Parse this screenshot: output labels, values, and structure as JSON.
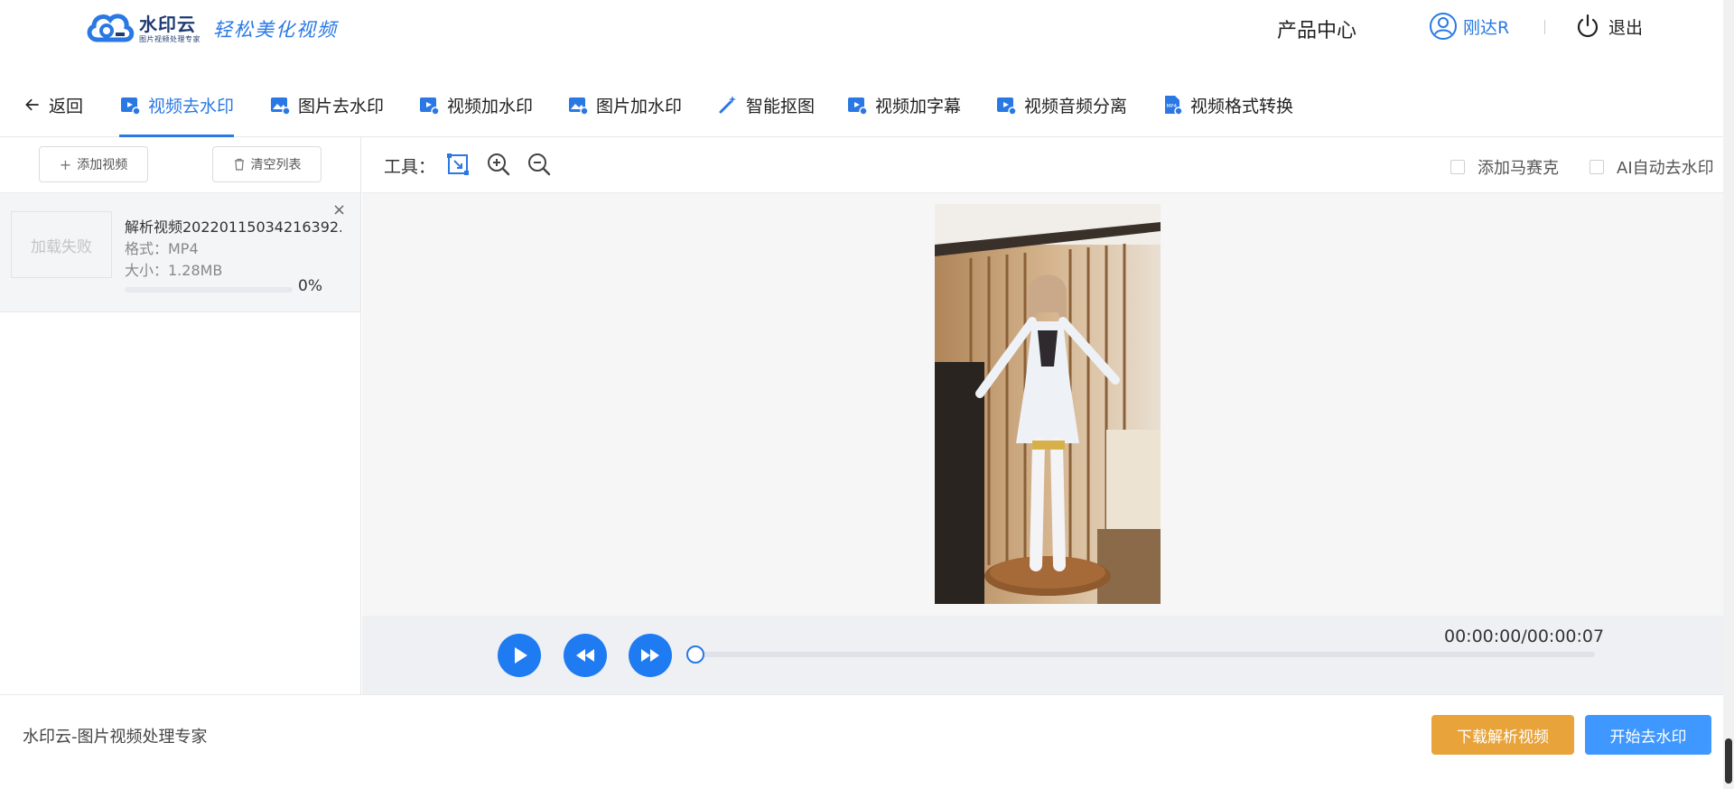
{
  "header": {
    "logo_name": "水印云",
    "logo_sub": "图片视频处理专家",
    "slogan": "轻松美化视频",
    "product_center": "产品中心",
    "user_name": "刚达R",
    "logout": "退出"
  },
  "tabs": [
    {
      "label": "返回",
      "icon": "arrow-left-icon"
    },
    {
      "label": "视频去水印",
      "icon": "video-icon",
      "active": true
    },
    {
      "label": "图片去水印",
      "icon": "image-icon"
    },
    {
      "label": "视频加水印",
      "icon": "video-icon"
    },
    {
      "label": "图片加水印",
      "icon": "image-icon"
    },
    {
      "label": "智能抠图",
      "icon": "magic-wand-icon"
    },
    {
      "label": "视频加字幕",
      "icon": "video-icon"
    },
    {
      "label": "视频音频分离",
      "icon": "video-icon"
    },
    {
      "label": "视频格式转换",
      "icon": "mp4-file-icon"
    }
  ],
  "left_panel": {
    "add_video": "添加视频",
    "clear_list": "清空列表",
    "file": {
      "thumb_status": "加载失败",
      "name": "解析视频20220115034216392...",
      "format": "格式：MP4",
      "size": "大小：1.28MB",
      "progress": 0,
      "progress_label": "0%"
    }
  },
  "toolbar": {
    "label": "工具：",
    "mosaic": "添加马赛克",
    "ai_remove": "AI自动去水印"
  },
  "player": {
    "time": "00:00:00/00:00:07",
    "position": 0
  },
  "footer": {
    "brand": "水印云-图片视频处理专家",
    "download_btn": "下载解析视频",
    "start_btn": "开始去水印"
  },
  "colors": {
    "accent": "#2a78e4",
    "play_button": "#1f7bf2",
    "download_button": "#e8a43a",
    "start_button": "#3f98ff"
  }
}
